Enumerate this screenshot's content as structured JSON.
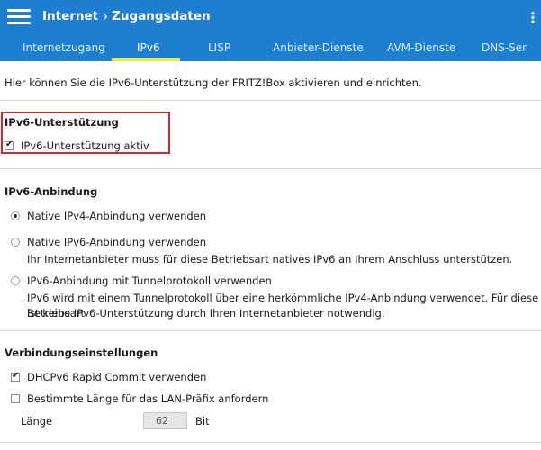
{
  "header": {
    "breadcrumb_root": "Internet",
    "breadcrumb_sep": "›",
    "breadcrumb_current": "Zugangsdaten",
    "help_glyph": "⋮"
  },
  "tabs": [
    {
      "label": "Internetzugang"
    },
    {
      "label": "IPv6"
    },
    {
      "label": "LISP"
    },
    {
      "label": "Anbieter-Dienste"
    },
    {
      "label": "AVM-Dienste"
    },
    {
      "label": "DNS-Ser"
    }
  ],
  "intro": "Hier können Sie die IPv6-Unterstützung der FRITZ!Box aktivieren und einrichten.",
  "ipv6_support": {
    "title": "IPv6-Unterstützung",
    "checkbox_label": "IPv6-Unterstützung aktiv",
    "checked": true
  },
  "ipv6_binding": {
    "title": "IPv6-Anbindung",
    "options": [
      {
        "label": "Native IPv4-Anbindung verwenden",
        "selected": true
      },
      {
        "label": "Native IPv6-Anbindung verwenden",
        "selected": false,
        "desc_1": "Ihr Internetanbieter muss für diese Betriebsart natives IPv6 an Ihrem Anschluss unterstützen."
      },
      {
        "label": "IPv6-Anbindung mit Tunnelprotokoll verwenden",
        "selected": false,
        "desc_1": "IPv6 wird mit einem Tunnelprotokoll über eine herkömmliche IPv4-Anbindung verwendet. Für diese Betriebsart",
        "desc_2": "ist keine IPv6-Unterstützung durch Ihren Internetanbieter notwendig."
      }
    ]
  },
  "connection_settings": {
    "title": "Verbindungseinstellungen",
    "dhcp_label": "DHCPv6 Rapid Commit verwenden",
    "dhcp_checked": true,
    "prefix_label": "Bestimmte Länge für das LAN-Präfix anfordern",
    "prefix_checked": false,
    "length_label": "Länge",
    "length_value": "62",
    "length_unit": "Bit"
  },
  "colors": {
    "header_bg": "#1e7fd1",
    "tab_underline": "#f3ef2a",
    "highlight_border": "#d8262e"
  }
}
